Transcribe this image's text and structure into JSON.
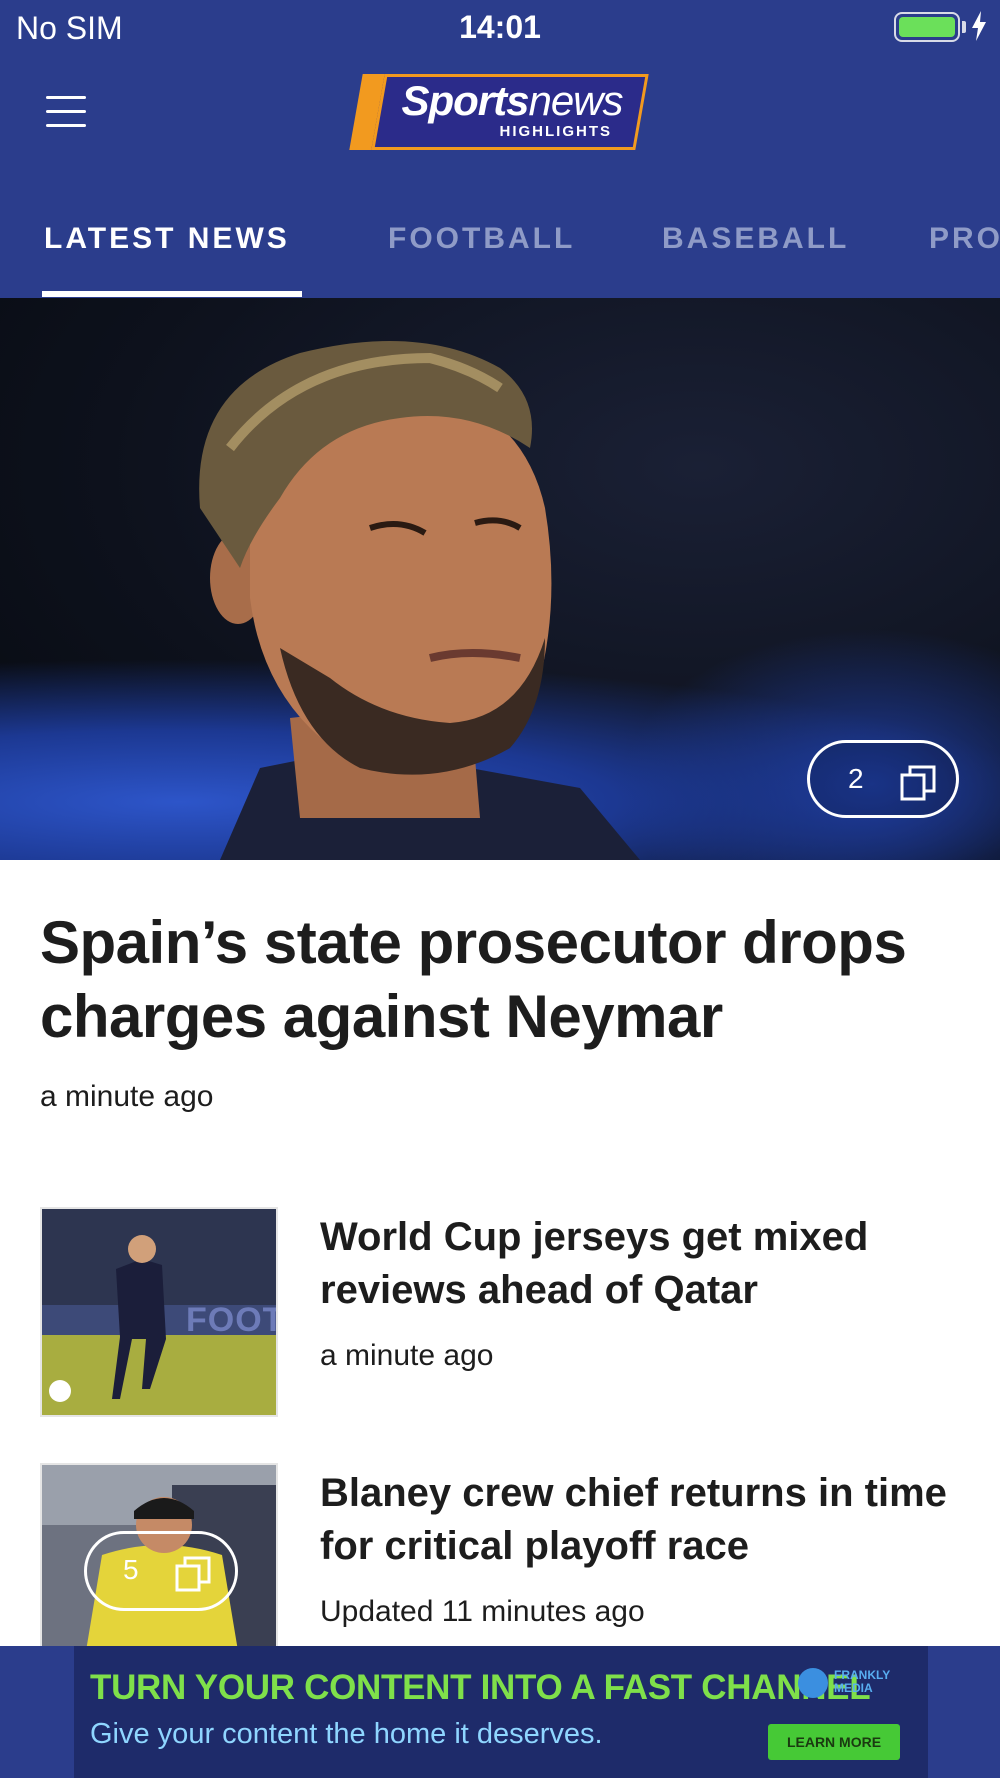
{
  "status": {
    "carrier": "No SIM",
    "time": "14:01",
    "battery_level": 1.0
  },
  "header": {
    "logo_bold": "Sports",
    "logo_thin": "news",
    "logo_sub": "HIGHLIGHTS",
    "tabs": [
      {
        "label": "LATEST NEWS",
        "active": true
      },
      {
        "label": "FOOTBALL",
        "active": false
      },
      {
        "label": "BASEBALL",
        "active": false
      },
      {
        "label": "PRO",
        "active": false
      }
    ]
  },
  "lead": {
    "gallery_count": "2",
    "title": "Spain’s state prosecutor drops charges against Neymar",
    "time": "a minute ago"
  },
  "articles": [
    {
      "title": "World Cup jerseys get mixed reviews ahead of Qatar",
      "time": "a minute ago",
      "thumb_text": "FOOTE"
    },
    {
      "title": "Blaney crew chief returns in time for critical playoff race",
      "time": "Updated 11 minutes ago",
      "gallery_count": "5"
    }
  ],
  "ad": {
    "headline": "TURN YOUR CONTENT INTO A FAST CHANNEL",
    "subline": "Give your content the home it deserves.",
    "brand": "FRANKLY MEDIA",
    "cta": "LEARN MORE"
  },
  "colors": {
    "header_bg": "#2b3d8c",
    "logo_accent": "#f29a1f",
    "ad_green": "#7fe04a"
  }
}
